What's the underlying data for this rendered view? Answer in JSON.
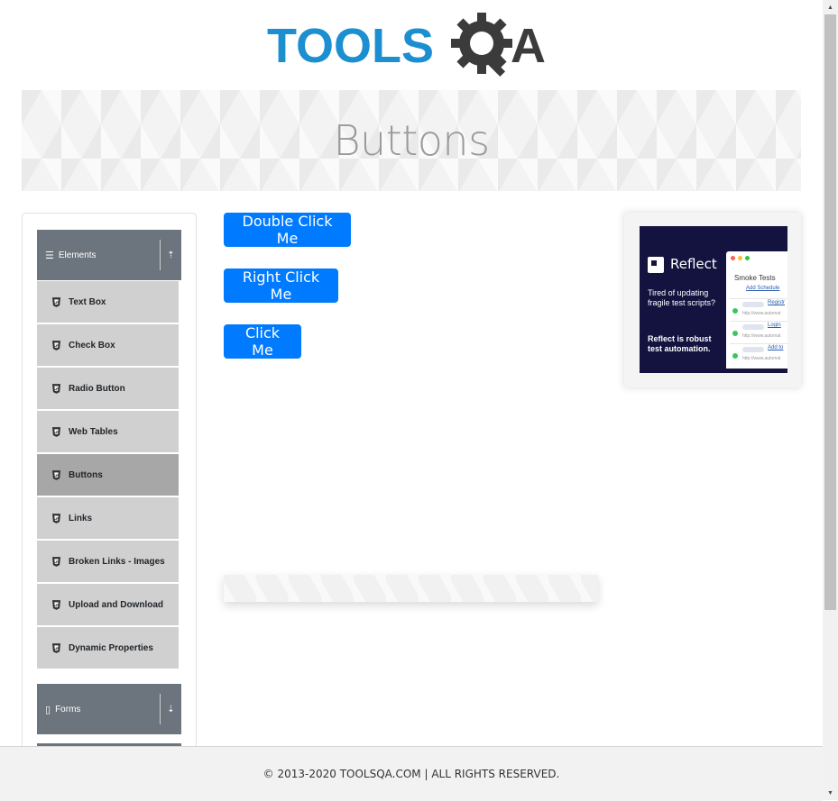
{
  "logo": {
    "text_left": "TOOLS",
    "text_right": "A"
  },
  "banner": {
    "title": "Buttons"
  },
  "sidebar": {
    "groups": [
      {
        "label": "Elements",
        "expanded": true
      },
      {
        "label": "Forms",
        "expanded": false
      }
    ],
    "items": [
      {
        "label": "Text Box"
      },
      {
        "label": "Check Box"
      },
      {
        "label": "Radio Button"
      },
      {
        "label": "Web Tables"
      },
      {
        "label": "Buttons",
        "active": true
      },
      {
        "label": "Links"
      },
      {
        "label": "Broken Links - Images"
      },
      {
        "label": "Upload and Download"
      },
      {
        "label": "Dynamic Properties"
      }
    ]
  },
  "buttons": {
    "double_click": "Double Click Me",
    "right_click": "Right Click Me",
    "click": "Click Me"
  },
  "ad": {
    "brand": "Reflect",
    "text1": "Tired of updating fragile test scripts?",
    "text2": "Reflect is robust test automation.",
    "panel_title": "Smoke Tests",
    "panel_link": "Add Schedule",
    "rows": [
      {
        "name": "Registr",
        "url": "http://www.automat"
      },
      {
        "name": "Login",
        "url": "http://www.automat"
      },
      {
        "name": "Add to",
        "url": "http://www.automat"
      }
    ]
  },
  "footer": {
    "text": "© 2013-2020 TOOLSQA.COM | ALL RIGHTS RESERVED."
  },
  "colors": {
    "primary": "#007bff",
    "group_header": "#6c757d",
    "menu_item": "#d0d0d0",
    "menu_active": "#a7a7a7"
  }
}
